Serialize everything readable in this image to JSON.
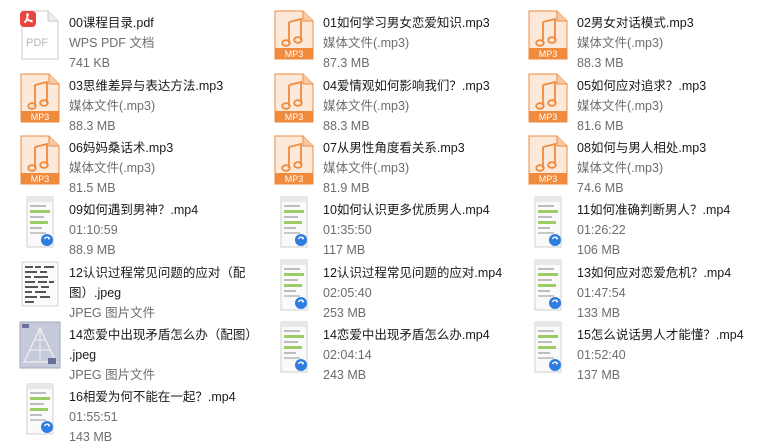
{
  "colors": {
    "mp3_orange": "#f08a3c",
    "pdf_red": "#e8453c",
    "text_primary": "#1a1a1a",
    "text_secondary": "#6d6d6d"
  },
  "items": [
    {
      "icon": "pdf",
      "name": "00课程目录.pdf",
      "meta1": "WPS PDF 文档",
      "meta2": "741 KB"
    },
    {
      "icon": "mp3",
      "name": "01如何学习男女恋爱知识.mp3",
      "meta1": "媒体文件(.mp3)",
      "meta2": "87.3 MB"
    },
    {
      "icon": "mp3",
      "name": "02男女对话模式.mp3",
      "meta1": "媒体文件(.mp3)",
      "meta2": "88.3 MB"
    },
    {
      "icon": "mp3",
      "name": "03思维差异与表达方法.mp3",
      "meta1": "媒体文件(.mp3)",
      "meta2": "88.3 MB"
    },
    {
      "icon": "mp3",
      "name": "04爱情观如何影响我们？.mp3",
      "meta1": "媒体文件(.mp3)",
      "meta2": "88.3 MB"
    },
    {
      "icon": "mp3",
      "name": "05如何应对追求？.mp3",
      "meta1": "媒体文件(.mp3)",
      "meta2": "81.6 MB"
    },
    {
      "icon": "mp3",
      "name": "06妈妈桑话术.mp3",
      "meta1": "媒体文件(.mp3)",
      "meta2": "81.5 MB"
    },
    {
      "icon": "mp3",
      "name": "07从男性角度看关系.mp3",
      "meta1": "媒体文件(.mp3)",
      "meta2": "81.9 MB"
    },
    {
      "icon": "mp3",
      "name": "08如何与男人相处.mp3",
      "meta1": "媒体文件(.mp3)",
      "meta2": "74.6 MB"
    },
    {
      "icon": "mp4",
      "name": "09如何遇到男神？.mp4",
      "meta1": "01:10:59",
      "meta2": "88.9 MB"
    },
    {
      "icon": "mp4",
      "name": "10如何认识更多优质男人.mp4",
      "meta1": "01:35:50",
      "meta2": "117 MB"
    },
    {
      "icon": "mp4",
      "name": "11如何准确判断男人？.mp4",
      "meta1": "01:26:22",
      "meta2": "106 MB"
    },
    {
      "icon": "jpeg-text",
      "name": "12认识过程常见问题的应对（配",
      "name2": "图）.jpeg",
      "meta1": "JPEG 图片文件"
    },
    {
      "icon": "mp4",
      "name": "12认识过程常见问题的应对.mp4",
      "meta1": "02:05:40",
      "meta2": "253 MB"
    },
    {
      "icon": "mp4",
      "name": "13如何应对恋爱危机？.mp4",
      "meta1": "01:47:54",
      "meta2": "133 MB"
    },
    {
      "icon": "jpeg-diagram",
      "name": "14恋爱中出现矛盾怎么办（配图）",
      "name2": ".jpeg",
      "meta1": "JPEG 图片文件"
    },
    {
      "icon": "mp4",
      "name": "14恋爱中出现矛盾怎么办.mp4",
      "meta1": "02:04:14",
      "meta2": "243 MB"
    },
    {
      "icon": "mp4",
      "name": "15怎么说话男人才能懂？.mp4",
      "meta1": "01:52:40",
      "meta2": "137 MB"
    },
    {
      "icon": "mp4",
      "name": "16相爱为何不能在一起？.mp4",
      "meta1": "01:55:51",
      "meta2": "143 MB"
    }
  ]
}
